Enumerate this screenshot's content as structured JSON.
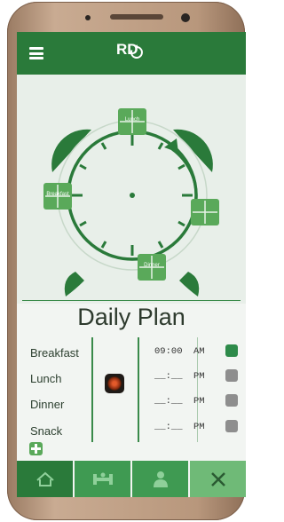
{
  "app": {
    "logo_text": "RD"
  },
  "clock": {
    "markers": [
      {
        "label": "Lunch"
      },
      {
        "label": "Breakfast"
      },
      {
        "label": ""
      },
      {
        "label": "Dinner"
      }
    ]
  },
  "plan": {
    "title": "Daily Plan",
    "rows": [
      {
        "meal": "Breakfast",
        "time": "09:00",
        "ampm": "AM",
        "alarm_on": true
      },
      {
        "meal": "Lunch",
        "time": "__:__",
        "ampm": "PM",
        "alarm_on": false
      },
      {
        "meal": "Dinner",
        "time": "__:__",
        "ampm": "PM",
        "alarm_on": false
      },
      {
        "meal": "Snack",
        "time": "__:__",
        "ampm": "PM",
        "alarm_on": false
      }
    ]
  },
  "tabs": [
    {
      "icon": "home-icon",
      "active": true
    },
    {
      "icon": "fitness-icon",
      "active": false
    },
    {
      "icon": "doctor-icon",
      "active": false
    },
    {
      "icon": "tools-icon",
      "active": false
    }
  ],
  "colors": {
    "primary": "#2a7a3a",
    "accent": "#5aa95a",
    "bell_on": "#2e8b4a",
    "bell_off": "#8e8e8e"
  }
}
